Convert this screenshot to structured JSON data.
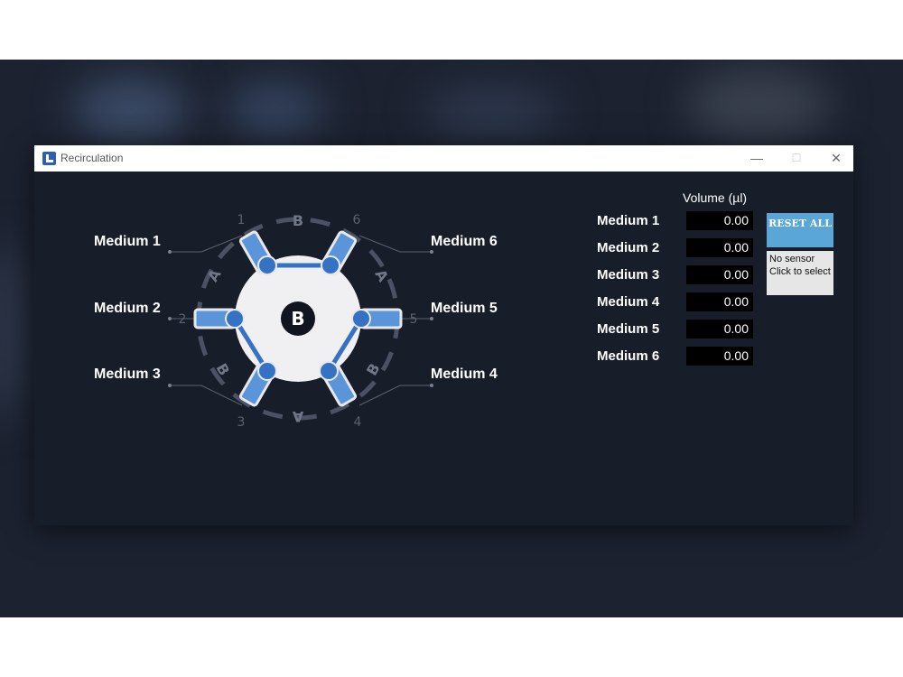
{
  "window": {
    "title": "Recirculation",
    "controls": {
      "minimize": "—",
      "maximize": "☐",
      "close": "✕"
    }
  },
  "valve": {
    "center_label": "B",
    "port_numbers": [
      "1",
      "2",
      "3",
      "4",
      "5",
      "6"
    ],
    "ring_letters": [
      "B",
      "A",
      "A",
      "B",
      "A",
      "B"
    ],
    "media_labels": [
      "Medium 1",
      "Medium 2",
      "Medium 3",
      "Medium 4",
      "Medium 5",
      "Medium 6"
    ]
  },
  "volume": {
    "header": "Volume (µl)",
    "rows": [
      {
        "label": "Medium 1",
        "value": "0.00"
      },
      {
        "label": "Medium 2",
        "value": "0.00"
      },
      {
        "label": "Medium 3",
        "value": "0.00"
      },
      {
        "label": "Medium 4",
        "value": "0.00"
      },
      {
        "label": "Medium 5",
        "value": "0.00"
      },
      {
        "label": "Medium 6",
        "value": "0.00"
      }
    ]
  },
  "actions": {
    "reset_label": "RESET ALL",
    "sensor_status": "No sensor Click to select"
  },
  "colors": {
    "window_bg": "#181d2a",
    "accent_blue": "#3572c4",
    "port_blue": "#5b95d9",
    "reset_button": "#5aa6d6"
  }
}
